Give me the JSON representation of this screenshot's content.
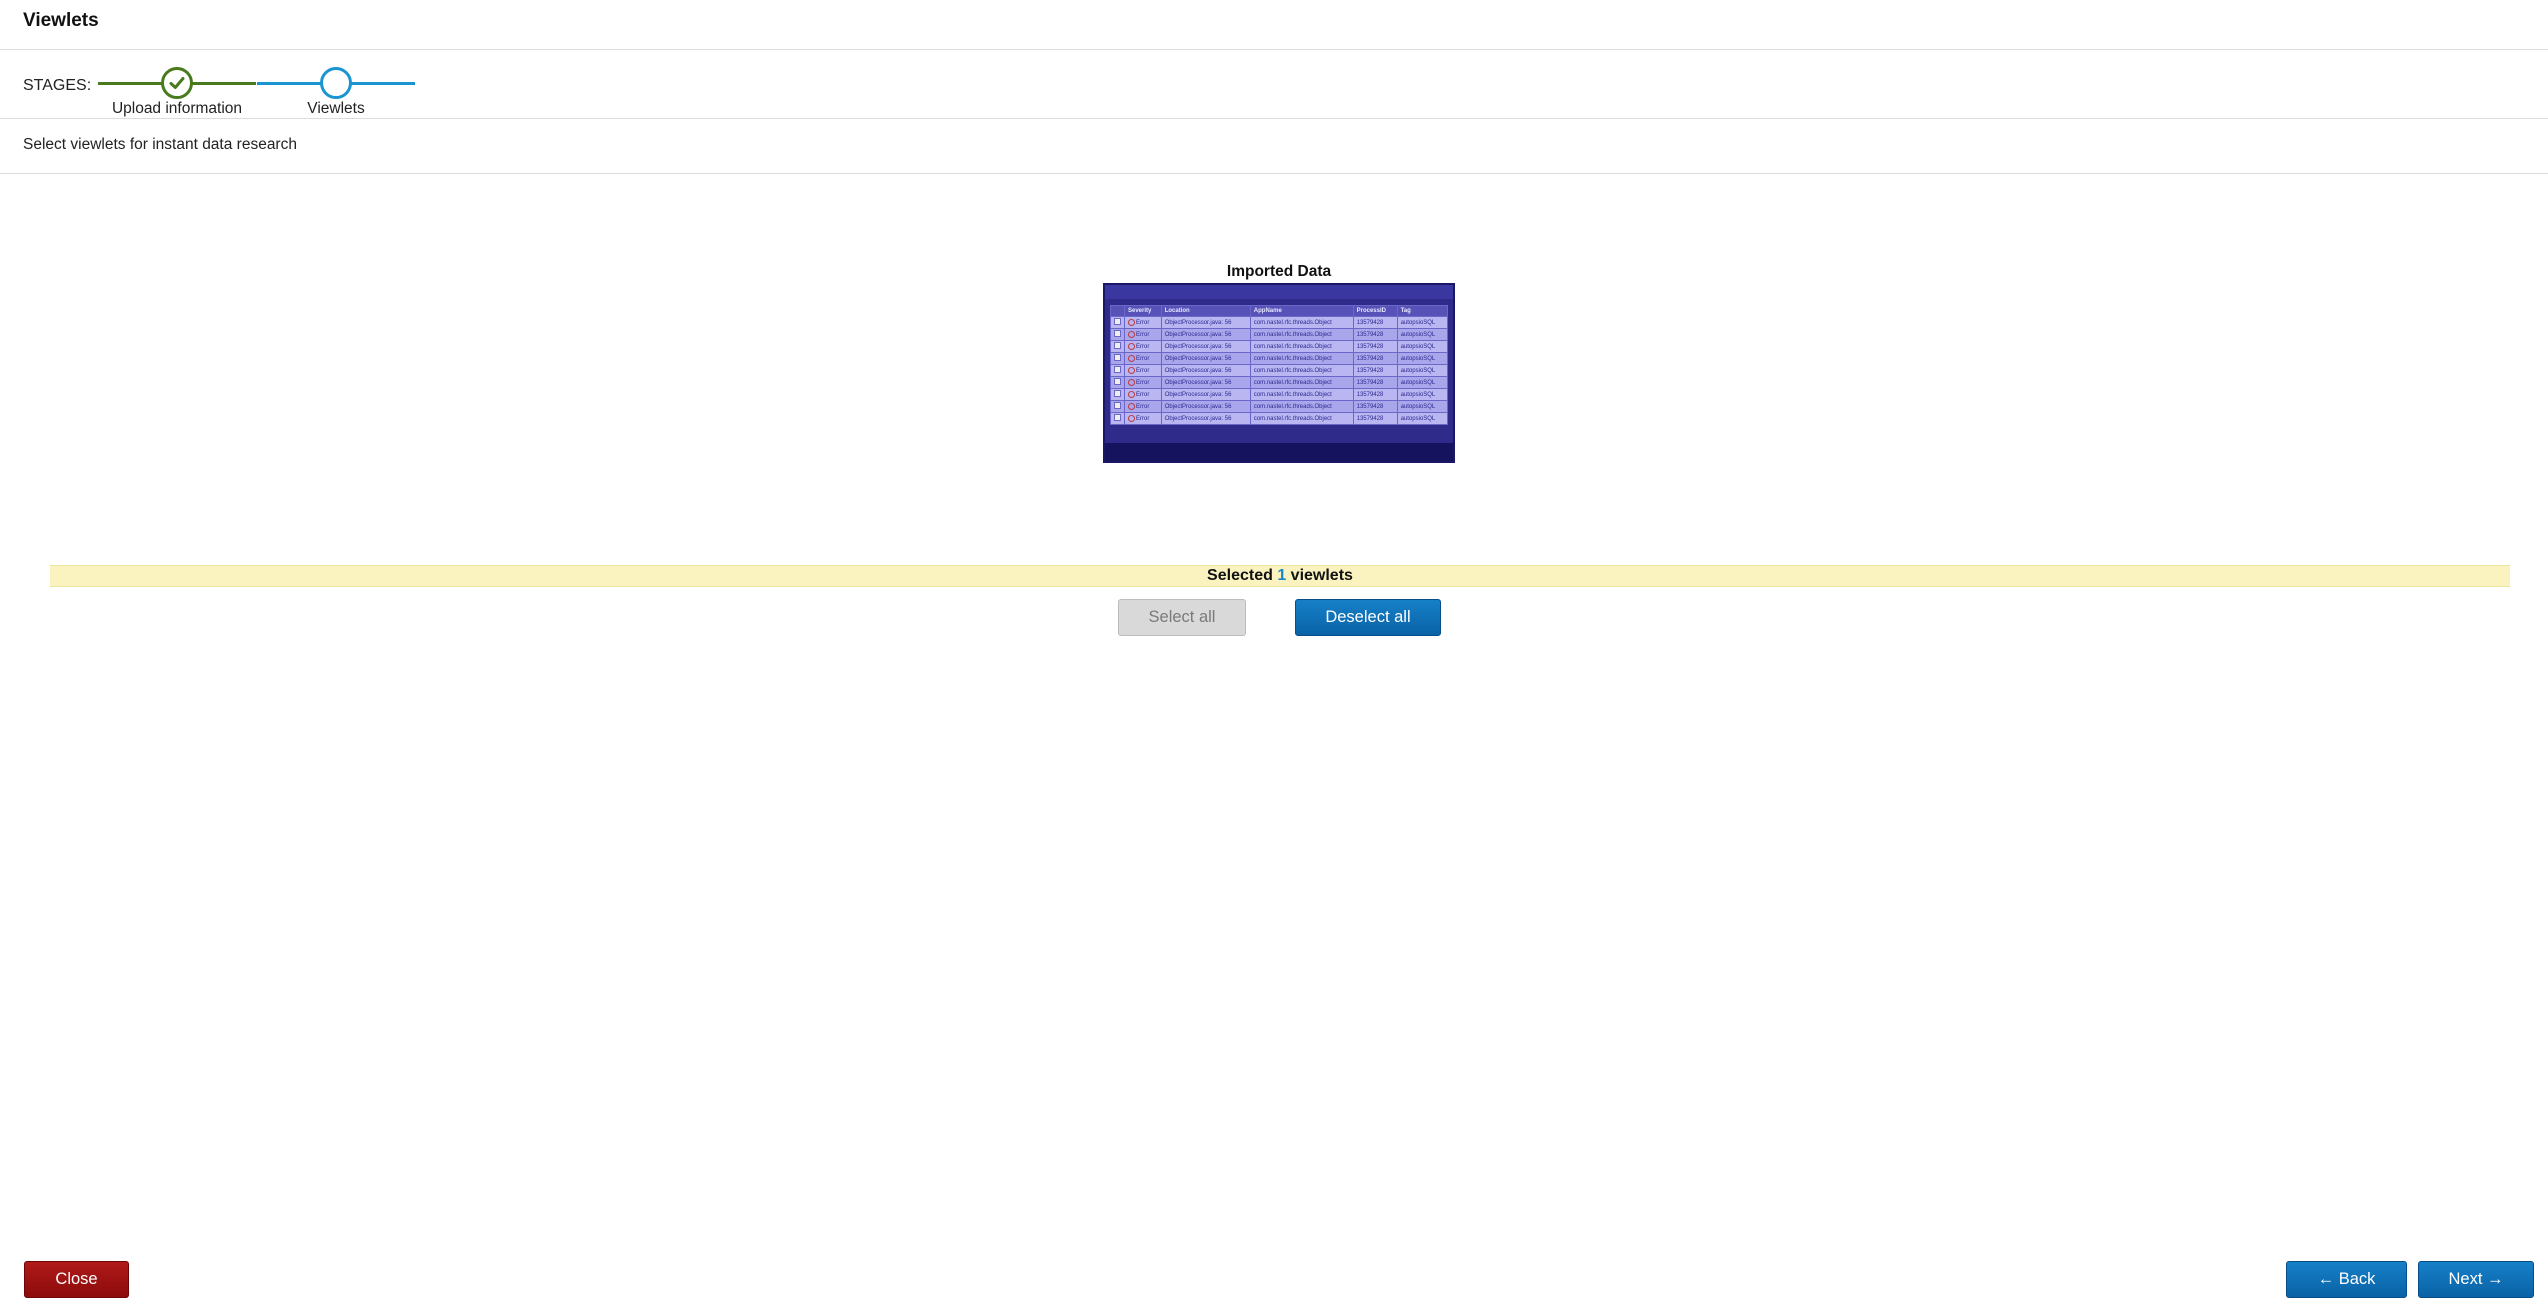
{
  "window": {
    "title": "Viewlets"
  },
  "stages": {
    "label": "STAGES:",
    "items": [
      {
        "name": "Upload information",
        "status": "complete",
        "color": "#4a7a1e"
      },
      {
        "name": "Viewlets",
        "status": "current",
        "color": "#1a95d2"
      }
    ]
  },
  "instructions": "Select viewlets for instant data research",
  "viewlets": [
    {
      "caption": "Imported Data",
      "thumbnail": {
        "columns": [
          "",
          "Severity",
          "Location",
          "AppName",
          "ProcessID",
          "Tag"
        ],
        "rows": [
          [
            "",
            "Error",
            "ObjectProcessor.java: 56",
            "com.nastel.rfc.threads.Object",
            "13579428",
            "autopsioSQL"
          ],
          [
            "",
            "Error",
            "ObjectProcessor.java: 56",
            "com.nastel.rfc.threads.Object",
            "13579428",
            "autopsioSQL"
          ],
          [
            "",
            "Error",
            "ObjectProcessor.java: 56",
            "com.nastel.rfc.threads.Object",
            "13579428",
            "autopsioSQL"
          ],
          [
            "",
            "Error",
            "ObjectProcessor.java: 56",
            "com.nastel.rfc.threads.Object",
            "13579428",
            "autopsioSQL"
          ],
          [
            "",
            "Error",
            "ObjectProcessor.java: 56",
            "com.nastel.rfc.threads.Object",
            "13579428",
            "autopsioSQL"
          ],
          [
            "",
            "Error",
            "ObjectProcessor.java: 56",
            "com.nastel.rfc.threads.Object",
            "13579428",
            "autopsioSQL"
          ],
          [
            "",
            "Error",
            "ObjectProcessor.java: 56",
            "com.nastel.rfc.threads.Object",
            "13579428",
            "autopsioSQL"
          ],
          [
            "",
            "Error",
            "ObjectProcessor.java: 56",
            "com.nastel.rfc.threads.Object",
            "13579428",
            "autopsioSQL"
          ],
          [
            "",
            "Error",
            "ObjectProcessor.java: 56",
            "com.nastel.rfc.threads.Object",
            "13579428",
            "autopsioSQL"
          ]
        ]
      }
    }
  ],
  "selection": {
    "prefix": "Selected",
    "count": "1",
    "suffix": "viewlets"
  },
  "buttons": {
    "select_all": "Select all",
    "deselect_all": "Deselect all",
    "close": "Close",
    "back": "← Back",
    "next": "Next →"
  }
}
